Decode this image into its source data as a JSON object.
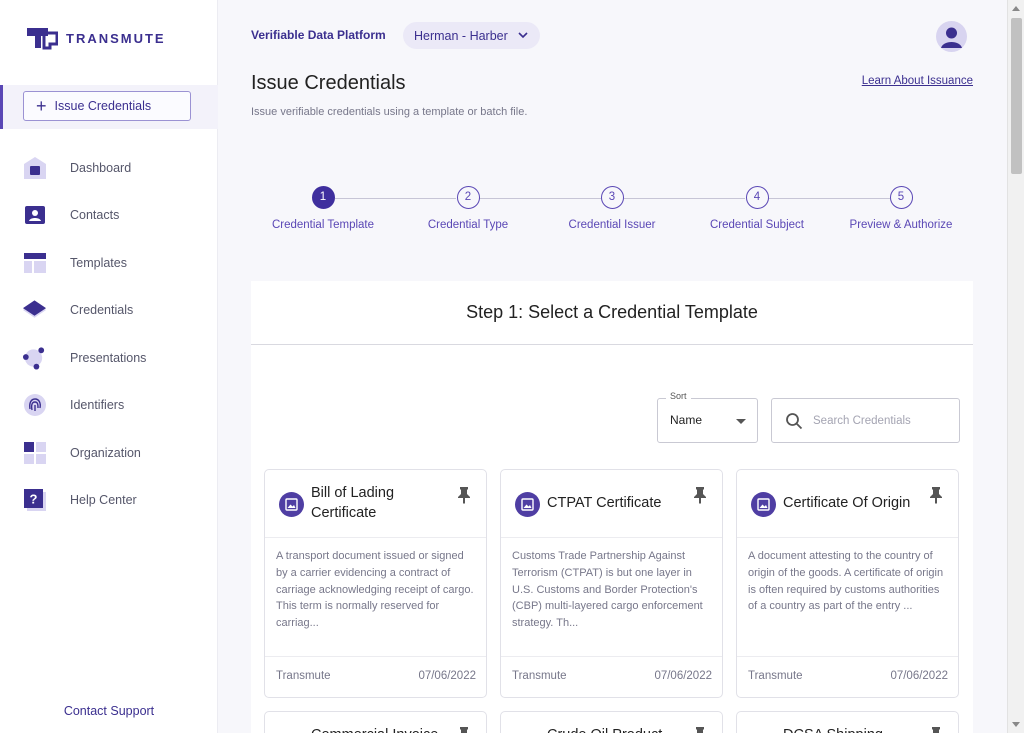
{
  "brand": {
    "name": "TRANSMUTE",
    "accent": "#3f2f9e",
    "accent_light": "#ebe9f7"
  },
  "sidebar": {
    "issue_button": "Issue Credentials",
    "items": [
      {
        "label": "Dashboard",
        "icon": "dashboard-icon"
      },
      {
        "label": "Contacts",
        "icon": "contacts-icon"
      },
      {
        "label": "Templates",
        "icon": "templates-icon"
      },
      {
        "label": "Credentials",
        "icon": "credentials-icon"
      },
      {
        "label": "Presentations",
        "icon": "presentations-icon"
      },
      {
        "label": "Identifiers",
        "icon": "fingerprint-icon"
      },
      {
        "label": "Organization",
        "icon": "organization-icon"
      },
      {
        "label": "Help Center",
        "icon": "help-icon"
      }
    ],
    "contact_support": "Contact Support"
  },
  "header": {
    "platform": "Verifiable Data Platform",
    "org_select": "Herman - Harber"
  },
  "page": {
    "title": "Issue Credentials",
    "subtitle": "Issue verifiable credentials using a template or batch file.",
    "learn_link": "Learn About Issuance"
  },
  "stepper": {
    "steps": [
      {
        "num": "1",
        "label": "Credential Template"
      },
      {
        "num": "2",
        "label": "Credential Type"
      },
      {
        "num": "3",
        "label": "Credential Issuer"
      },
      {
        "num": "4",
        "label": "Credential Subject"
      },
      {
        "num": "5",
        "label": "Preview & Authorize"
      }
    ]
  },
  "panel": {
    "title": "Step 1: Select a Credential Template",
    "sort": {
      "legend": "Sort",
      "value": "Name"
    },
    "search": {
      "placeholder": "Search Credentials",
      "value": ""
    },
    "cards": [
      {
        "title": "Bill of Lading Certificate",
        "description": "A transport document issued or signed by a carrier evidencing a contract of carriage acknowledging receipt of cargo. This term is normally reserved for carriag...",
        "issuer": "Transmute",
        "date": "07/06/2022"
      },
      {
        "title": "CTPAT Certificate",
        "description": "Customs Trade Partnership Against Terrorism (CTPAT) is but one layer in U.S. Customs and Border Protection's (CBP) multi-layered cargo enforcement strategy. Th...",
        "issuer": "Transmute",
        "date": "07/06/2022"
      },
      {
        "title": "Certificate Of Origin",
        "description": "A document attesting to the country of origin of the goods. A certificate of origin is often required by customs authorities of a country as part of the entry ...",
        "issuer": "Transmute",
        "date": "07/06/2022"
      }
    ],
    "next_cards": [
      {
        "title": "Commercial Invoice"
      },
      {
        "title": "Crude Oil Product"
      },
      {
        "title": "DCSA Shipping"
      }
    ]
  }
}
